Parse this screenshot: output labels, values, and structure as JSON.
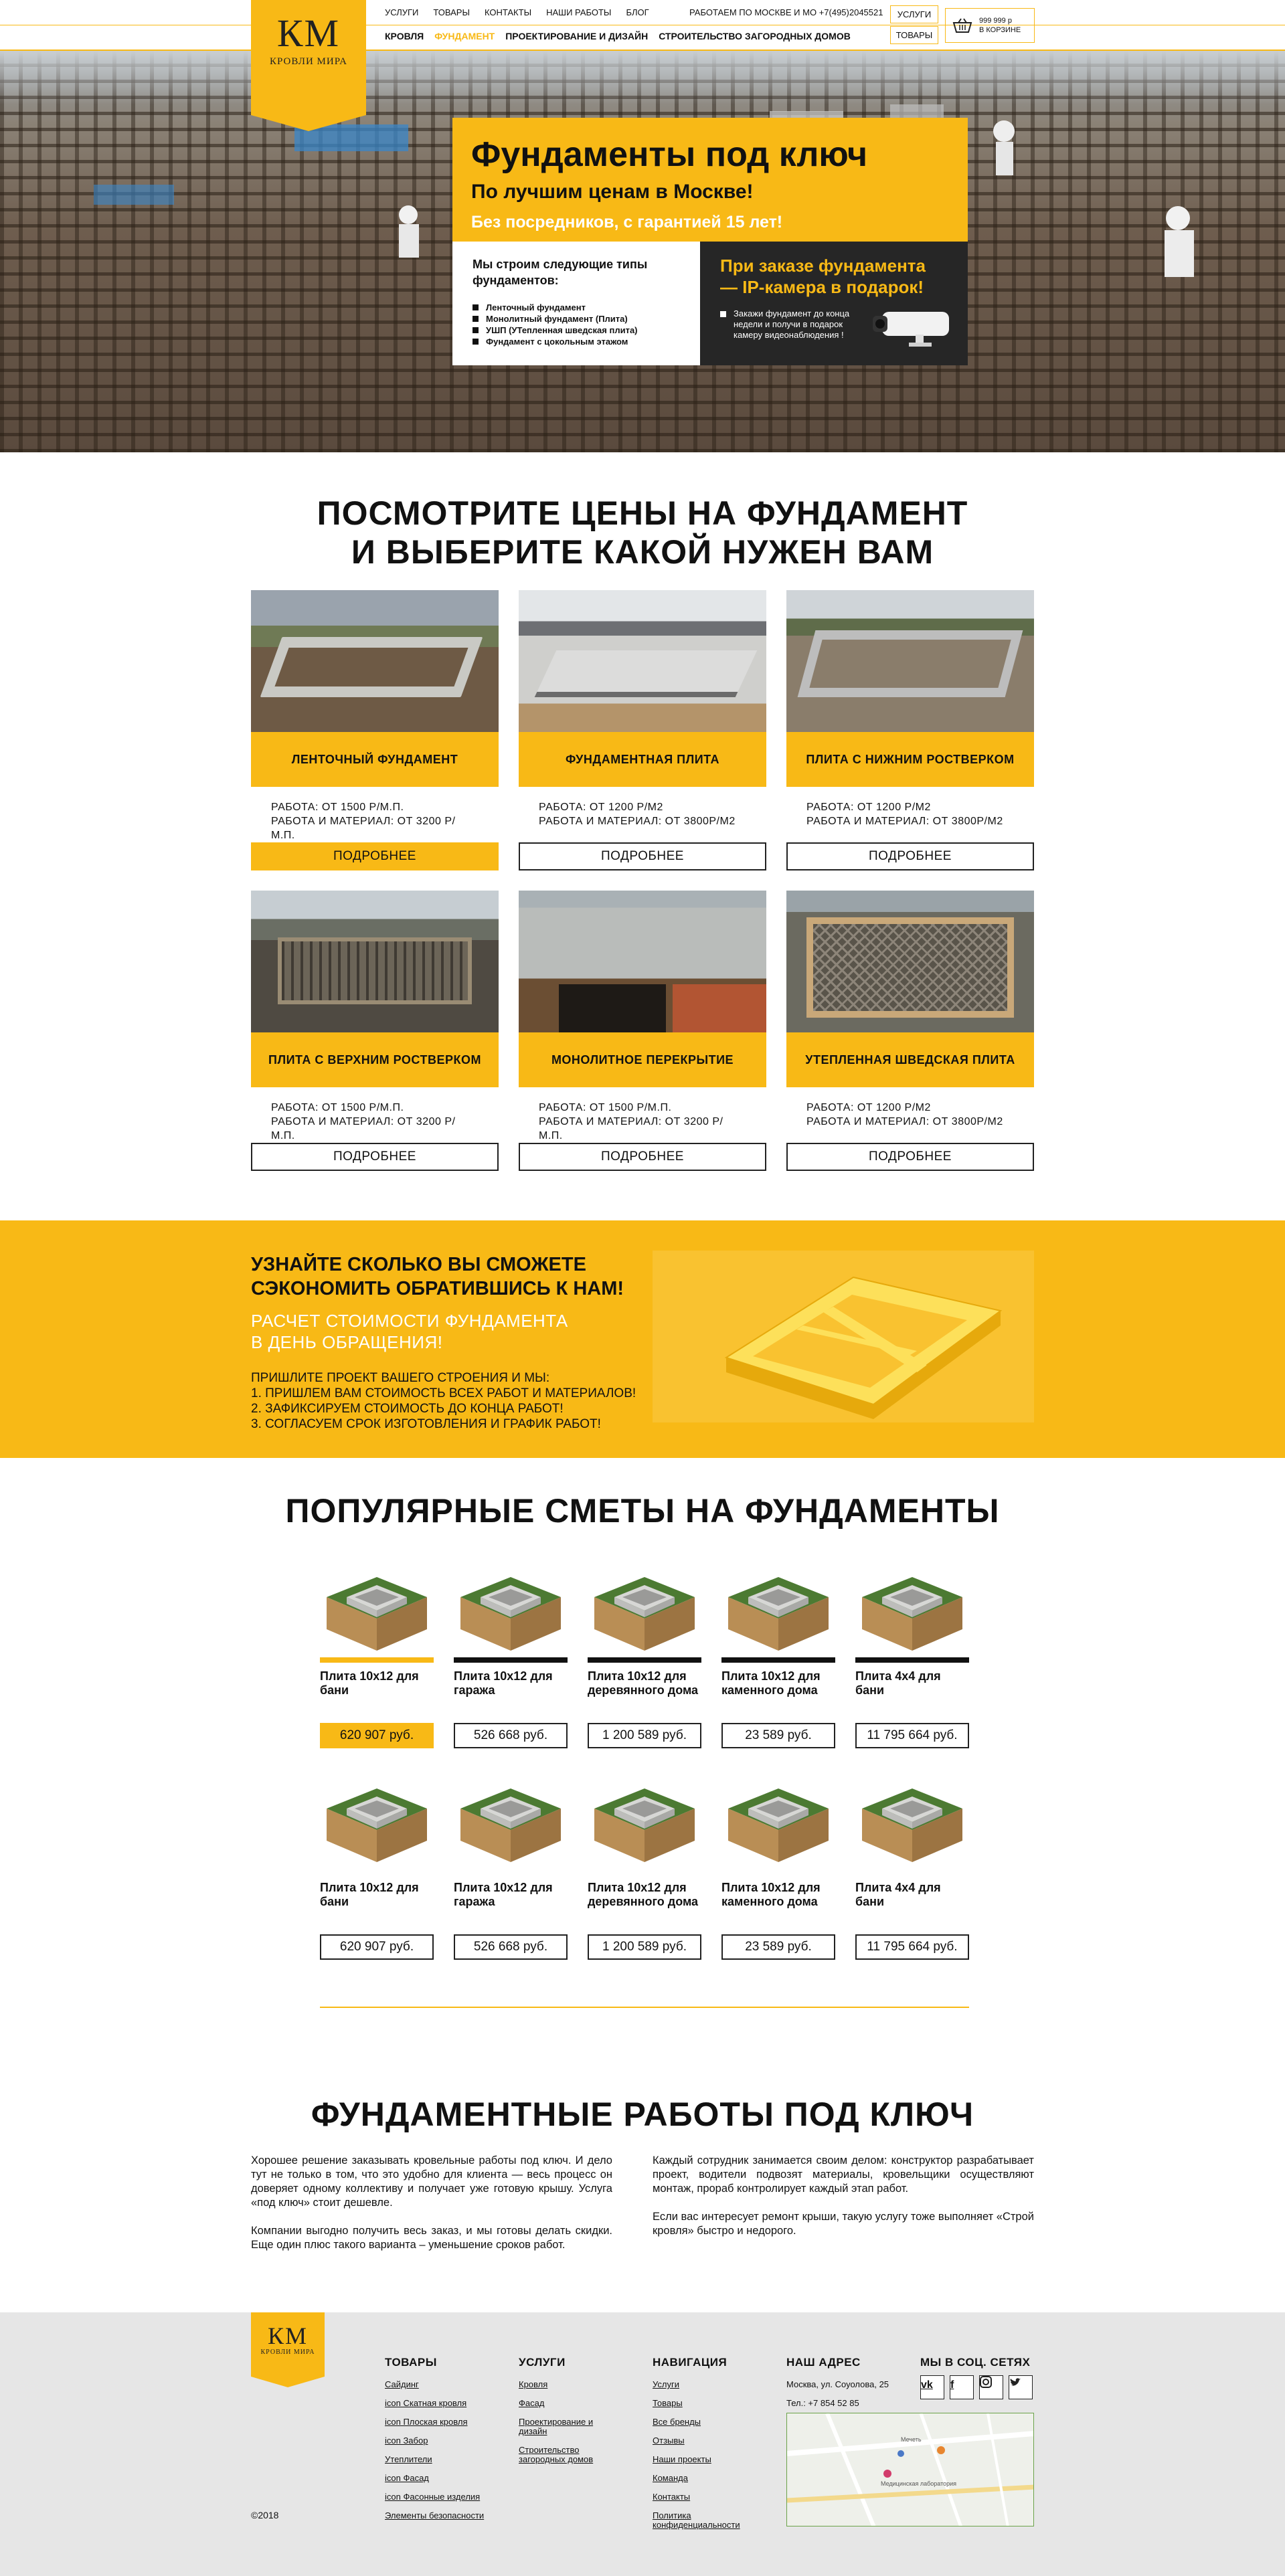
{
  "header": {
    "logo_mark": "КМ",
    "logo_sub": "КРОВЛИ МИРА",
    "top_links": [
      "УСЛУГИ",
      "ТОВАРЫ",
      "КОНТАКТЫ",
      "НАШИ РАБОТЫ",
      "БЛОГ"
    ],
    "contact": "РАБОТАЕМ ПО МОСКВЕ И МО +7(495)2045521",
    "nav": [
      "КРОВЛЯ",
      "ФУНДАМЕНТ",
      "ПРОЕКТИРОВАНИЕ И ДИЗАЙН",
      "СТРОИТЕЛЬСТВО ЗАГОРОДНЫХ ДОМОВ"
    ],
    "nav_active_index": 1,
    "btn_services": "УСЛУГИ",
    "btn_goods": "ТОВАРЫ",
    "cart_sum": "999 999 р",
    "cart_label": "В КОРЗИНЕ"
  },
  "hero": {
    "title": "Фундаменты под ключ",
    "subtitle": "По лучшим ценам в Москве!",
    "subtitle2": "Без посредников, с гарантией 15 лет!",
    "types_title": "Мы строим следующие типы фундаментов:",
    "types": [
      "Ленточный фундамент",
      "Монолитный фундамент (Плита)",
      "УШП (УТепленная шведская плита)",
      "Фундамент с цокольным этажом"
    ],
    "promo_title": "При заказе фундамента — IP-камера в подарок!",
    "promo_text": "Закажи фундамент до конца недели и получи в подарок камеру видеонаблюдения !"
  },
  "prices": {
    "title_line1": "ПОСМОТРИТЕ ЦЕНЫ НА ФУНДАМЕНТ",
    "title_line2": "И ВЫБЕРИТЕ КАКОЙ НУЖЕН ВАМ",
    "cards": [
      {
        "title": "ЛЕНТОЧНЫЙ ФУНДАМЕНТ",
        "line1": "РАБОТА: ОТ 1500 Р/М.П.",
        "line2": "РАБОТА И МАТЕРИАЛ: ОТ 3200 Р/М.П.",
        "button": "ПОДРОБНЕЕ"
      },
      {
        "title": "ФУНДАМЕНТНАЯ ПЛИТА",
        "line1": "РАБОТА: ОТ 1200 Р/М2",
        "line2": "РАБОТА И МАТЕРИАЛ: ОТ 3800Р/М2",
        "button": "ПОДРОБНЕЕ"
      },
      {
        "title": "ПЛИТА С НИЖНИМ РОСТВЕРКОМ",
        "line1": "РАБОТА: ОТ 1200 Р/М2",
        "line2": "РАБОТА И МАТЕРИАЛ: ОТ 3800Р/М2",
        "button": "ПОДРОБНЕЕ"
      },
      {
        "title": "ПЛИТА С ВЕРХНИМ РОСТВЕРКОМ",
        "line1": "РАБОТА: ОТ 1500 Р/М.П.",
        "line2": "РАБОТА И МАТЕРИАЛ: ОТ 3200 Р/М.П.",
        "button": "ПОДРОБНЕЕ"
      },
      {
        "title": "МОНОЛИТНОЕ ПЕРЕКРЫТИЕ",
        "line1": "РАБОТА: ОТ 1500 Р/М.П.",
        "line2": "РАБОТА И МАТЕРИАЛ: ОТ 3200 Р/М.П.",
        "button": "ПОДРОБНЕЕ"
      },
      {
        "title": "УТЕПЛЕННАЯ ШВЕДСКАЯ ПЛИТА",
        "line1": "РАБОТА: ОТ 1200 Р/М2",
        "line2": "РАБОТА И МАТЕРИАЛ: ОТ 3800Р/М2",
        "button": "ПОДРОБНЕЕ"
      }
    ]
  },
  "savings": {
    "title_line1": "УЗНАЙТЕ СКОЛЬКО ВЫ СМОЖЕТЕ",
    "title_line2": "СЭКОНОМИТЬ ОБРАТИВШИСЬ К НАМ!",
    "sub_line1": "РАСЧЕТ СТОИМОСТИ ФУНДАМЕНТА",
    "sub_line2": "В ДЕНЬ ОБРАЩЕНИЯ!",
    "list": [
      "ПРИШЛИТЕ ПРОЕКТ ВАШЕГО СТРОЕНИЯ И МЫ:",
      "1. ПРИШЛЕМ ВАМ СТОИМОСТЬ ВСЕХ РАБОТ И МАТЕРИАЛОВ!",
      "2. ЗАФИКСИРУЕМ СТОИМОСТЬ ДО КОНЦА РАБОТ!",
      "3. СОГЛАСУЕМ СРОК ИЗГОТОВЛЕНИЯ И ГРАФИК РАБОТ!"
    ]
  },
  "estimates": {
    "title": "ПОПУЛЯРНЫЕ СМЕТЫ НА ФУНДАМЕНТЫ",
    "items": [
      {
        "name": "Плита 10х12 для бани",
        "price": "620 907 руб."
      },
      {
        "name": "Плита 10х12 для гаража",
        "price": "526 668 руб."
      },
      {
        "name": "Плита 10х12 для деревянного дома",
        "price": "1 200 589 руб."
      },
      {
        "name": "Плита 10х12 для каменного дома",
        "price": "23 589 руб."
      },
      {
        "name": "Плита 4х4 для бани",
        "price": "11 795 664 руб."
      },
      {
        "name": "Плита 10х12 для бани",
        "price": "620 907 руб."
      },
      {
        "name": "Плита 10х12 для гаража",
        "price": "526 668 руб."
      },
      {
        "name": "Плита 10х12 для деревянного дома",
        "price": "1 200 589 руб."
      },
      {
        "name": "Плита 10х12 для каменного дома",
        "price": "23 589 руб."
      },
      {
        "name": "Плита 4х4 для бани",
        "price": "11 795 664 руб."
      }
    ]
  },
  "works": {
    "title": "ФУНДАМЕНТНЫЕ РАБОТЫ ПОД КЛЮЧ",
    "p1": "Хорошее решение заказывать кровельные работы под ключ. И дело тут не только в том, что это удобно для клиента — весь процесс он доверяет одному коллективу и получает уже готовую крышу. Услуга «под ключ» стоит дешевле.",
    "p2": "Компании выгодно получить весь заказ, и мы готовы делать скидки. Еще один плюс такого варианта – уменьшение сроков работ.",
    "p3": "Каждый сотрудник занимается своим делом: конструктор разрабатывает проект, водители подвозят материалы, кровельщики осуществляют монтаж, прораб контролирует каждый этап работ.",
    "p4": "Если вас интересует ремонт крыши, такую услугу тоже выполняет «Строй кровля» быстро и недорого."
  },
  "footer": {
    "copyright": "©2018",
    "goods_title": "ТОВАРЫ",
    "goods": [
      "Сайдинг",
      "icon Скатная кровля",
      "icon Плоская кровля",
      "icon Забор",
      "Утеплители",
      "icon Фасад",
      "icon Фасонные изделия",
      "Элементы безопасности"
    ],
    "services_title": "УСЛУГИ",
    "services": [
      "Кровля",
      "Фасад",
      "Проектирование и дизайн",
      "Строительство загородных домов"
    ],
    "nav_title": "НАВИГАЦИЯ",
    "nav": [
      "Услуги",
      "Товары",
      "Все бренды",
      "Отзывы",
      "Наши проекты",
      "Команда",
      "Контакты",
      "Политика конфиденциальности"
    ],
    "address_title": "НАШ АДРЕС",
    "address": "Москва, ул. Соуолова, 25",
    "phone": "Тел.: +7 854 52 85",
    "social_title": "МЫ В СОЦ. СЕТЯХ",
    "social": [
      "vk-icon",
      "facebook-icon",
      "instagram-icon",
      "twitter-icon"
    ],
    "map_labels": [
      "Мечеть",
      "Медицинская лаборатория"
    ]
  }
}
